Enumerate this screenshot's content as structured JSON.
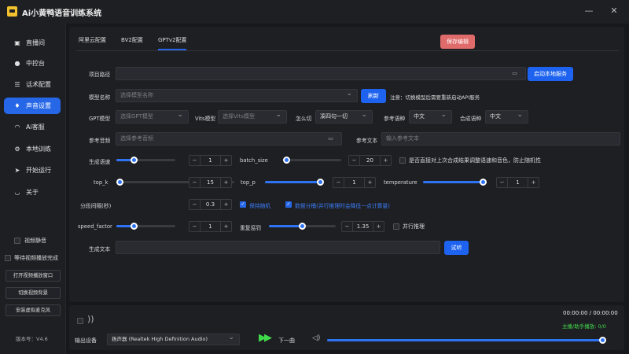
{
  "app": {
    "title": "Ai小黄鸭语音训练系统",
    "minimize": "—",
    "close": "✕"
  },
  "sidebar": {
    "items": [
      {
        "label": "直播间",
        "icon": "monitor-icon",
        "glyph": "▣"
      },
      {
        "label": "中控台",
        "icon": "user-icon",
        "glyph": "●"
      },
      {
        "label": "话术配置",
        "icon": "sliders-icon",
        "glyph": "☰"
      },
      {
        "label": "声音设置",
        "icon": "microphone-icon",
        "glyph": "♦"
      },
      {
        "label": "Ai客服",
        "icon": "headset-icon",
        "glyph": "◠"
      },
      {
        "label": "本地训练",
        "icon": "gear-icon",
        "glyph": "⚙"
      },
      {
        "label": "开始运行",
        "icon": "send-icon",
        "glyph": "➤"
      },
      {
        "label": "关于",
        "icon": "headphones-icon",
        "glyph": "◡"
      }
    ],
    "active_index": 3,
    "video_mute": "视频静音",
    "wait_video": "等待视频播放完成",
    "buttons": [
      "打开视频播放窗口",
      "切换视频背景",
      "安装虚拟麦克风"
    ],
    "version": "版本号：V4.6"
  },
  "tabs": [
    "阿里云配置",
    "BV2配置",
    "GPTv2配置"
  ],
  "active_tab": 2,
  "save_button": "保存编辑",
  "form": {
    "project_path": {
      "label": "项目路径",
      "value": ""
    },
    "start_local_service": "启动本地服务",
    "model_name": {
      "label": "模型名称",
      "placeholder": "选择模型名称"
    },
    "refresh": "刷新",
    "notice": "注意：切换模型后需要重新启动API服务",
    "gpt_model": {
      "label": "GPT模型",
      "placeholder": "选择GPT模型"
    },
    "vits_model": {
      "label": "Vits模型",
      "placeholder": "选择Vits模型"
    },
    "how_cut": {
      "label": "怎么切",
      "value": "凑四句一切"
    },
    "ref_lang": {
      "label": "参考语种",
      "value": "中文"
    },
    "synth_lang": {
      "label": "合成语种",
      "value": "中文"
    },
    "ref_audio": {
      "label": "参考音频",
      "placeholder": "选择参考音频"
    },
    "ref_text": {
      "label": "参考文本",
      "placeholder": "输入参考文本"
    },
    "gen_text": {
      "label": "生成文本",
      "value": ""
    },
    "try_button": "试听"
  },
  "params": {
    "speed": {
      "label": "生成语速",
      "value": "1",
      "fraction": 0.3
    },
    "batch_size": {
      "label": "batch_size",
      "value": "20",
      "fraction": 0.05
    },
    "use_last": "是否直接对上次合成结果调整语速和音色，防止随机性",
    "top_k": {
      "label": "top_k",
      "value": "15",
      "fraction": 0.02
    },
    "top_p": {
      "label": "top_p",
      "value": "1",
      "fraction": 1.0
    },
    "temperature": {
      "label": "temperature",
      "value": "1",
      "fraction": 1.0
    },
    "segment_interval": {
      "label": "分段间隔(秒)",
      "value": "0.3"
    },
    "random_seed": "保持随机",
    "split_bucket": "数据分桶(并行推理时会降低一点计算量)",
    "speed_factor": {
      "label": "speed_factor",
      "value": "1",
      "fraction": 0.3
    },
    "repetition_penalty": {
      "label": "重复惩罚",
      "value": "1.35",
      "fraction": 0.5
    },
    "parallel_infer": "并行推理"
  },
  "player": {
    "time": "00:00:00 / 00:00:00",
    "counts": "主播/助手播放: 0/0",
    "output_label": "输出设备",
    "output_device": "扬声器 (Realtek High Definition Audio)",
    "next": "下一曲",
    "volume": 1.0
  },
  "colors": {
    "accent": "#2667e8",
    "save": "#e06b6b",
    "green": "#3fd94a"
  }
}
